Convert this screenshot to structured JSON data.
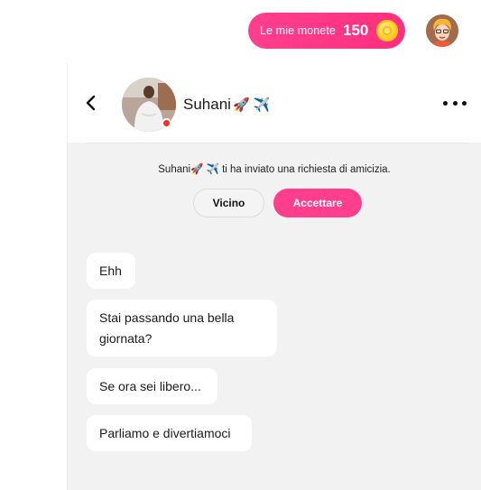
{
  "topbar": {
    "coins_label": "Le mie monete",
    "coins_count": "150",
    "icons": {
      "coin": "coin-icon",
      "avatar": "user-avatar"
    }
  },
  "chat": {
    "contact_name": "Suhani",
    "contact_emoji": "🚀 ✈️",
    "status_color": "#ff2a1f",
    "friend_request": {
      "text": "Suhani🚀 ✈️ ti ha inviato una richiesta di amicizia.",
      "decline_label": "Vicino",
      "accept_label": "Accettare"
    },
    "messages": [
      {
        "text": "Ehh"
      },
      {
        "text": "Stai passando una bella giornata?"
      },
      {
        "text": "Se ora sei libero..."
      },
      {
        "text": "Parliamo e divertiamoci"
      }
    ]
  },
  "colors": {
    "accent_pink": "#ff3e8e",
    "chat_background": "#f2f2f2",
    "bubble": "#ffffff"
  }
}
